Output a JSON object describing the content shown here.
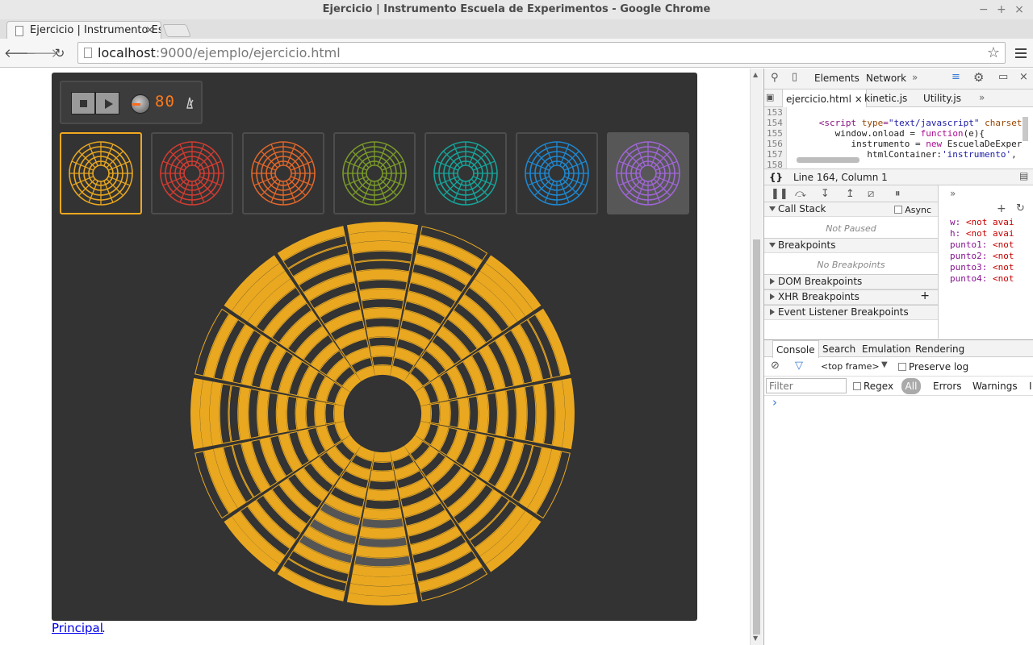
{
  "window": {
    "title": "Ejercicio | Instrumento Escuela de Experimentos - Google Chrome"
  },
  "browser": {
    "tab_title": "Ejercicio | Instrumento Escuela de Experimentos",
    "tab_close": "×",
    "url_host": "localhost",
    "url_rest": ":9000/ejemplo/ejercicio.html"
  },
  "instrument": {
    "tempo": "80",
    "themes": [
      {
        "name": "amarillo",
        "color": "#e9a820"
      },
      {
        "name": "rojo",
        "color": "#d23c32"
      },
      {
        "name": "naranja",
        "color": "#e2672a"
      },
      {
        "name": "verde",
        "color": "#7a9a2a"
      },
      {
        "name": "turquesa",
        "color": "#16a59b"
      },
      {
        "name": "azul",
        "color": "#1e88d2"
      },
      {
        "name": "violeta",
        "color": "#a066d8"
      }
    ],
    "selected_theme": 0,
    "wheel_color": "#e9a820",
    "wheel_bg": "#333333",
    "wheel_sectors": 16,
    "wheel_rings": 16,
    "wheel_highlight": "#555555"
  },
  "page": {
    "link_label": "Principal",
    "link_suffix": "."
  },
  "devtools": {
    "top_tabs": [
      "Elements",
      "Network"
    ],
    "more": "»",
    "files": [
      "ejercicio.html",
      "kinetic.js",
      "Utility.js"
    ],
    "file_close": "×",
    "code": {
      "l153": "153",
      "l154": "154",
      "c154a": "<script ",
      "c154b": "type",
      "c154c": "=",
      "c154d": "\"text/javascript\"",
      "c154e": " charset",
      "l155": "155",
      "c155a": "window.onload = ",
      "c155b": "function",
      "c155c": "(e){",
      "l156": "156",
      "c156a": "instrumento = ",
      "c156b": "new",
      "c156c": " EscuelaDeExper",
      "l157": "157",
      "c157a": "htmlContainer:",
      "c157b": "'instrumento'",
      "l158": "158"
    },
    "cursor": "Line 164, Column 1",
    "format_icon": "{}",
    "call_stack": "Call Stack",
    "async": "Async",
    "not_paused": "Not Paused",
    "breakpoints": "Breakpoints",
    "no_breakpoints": "No Breakpoints",
    "dom_breakpoints": "DOM Breakpoints",
    "xhr_breakpoints": "XHR Breakpoints",
    "event_breakpoints": "Event Listener Breakpoints",
    "watch": [
      {
        "key": "w: ",
        "val": "<not avai"
      },
      {
        "key": "h: ",
        "val": "<not avai"
      },
      {
        "key": "punto1: ",
        "val": "<not"
      },
      {
        "key": "punto2: ",
        "val": "<not"
      },
      {
        "key": "punto3: ",
        "val": "<not"
      },
      {
        "key": "punto4: ",
        "val": "<not"
      }
    ],
    "console_tabs": [
      "Console",
      "Search",
      "Emulation",
      "Rendering"
    ],
    "frame": "<top frame>",
    "preserve_log": "Preserve log",
    "filter_placeholder": "Filter",
    "regex": "Regex",
    "levels": [
      "All",
      "Errors",
      "Warnings",
      "I"
    ],
    "prompt": "›"
  }
}
